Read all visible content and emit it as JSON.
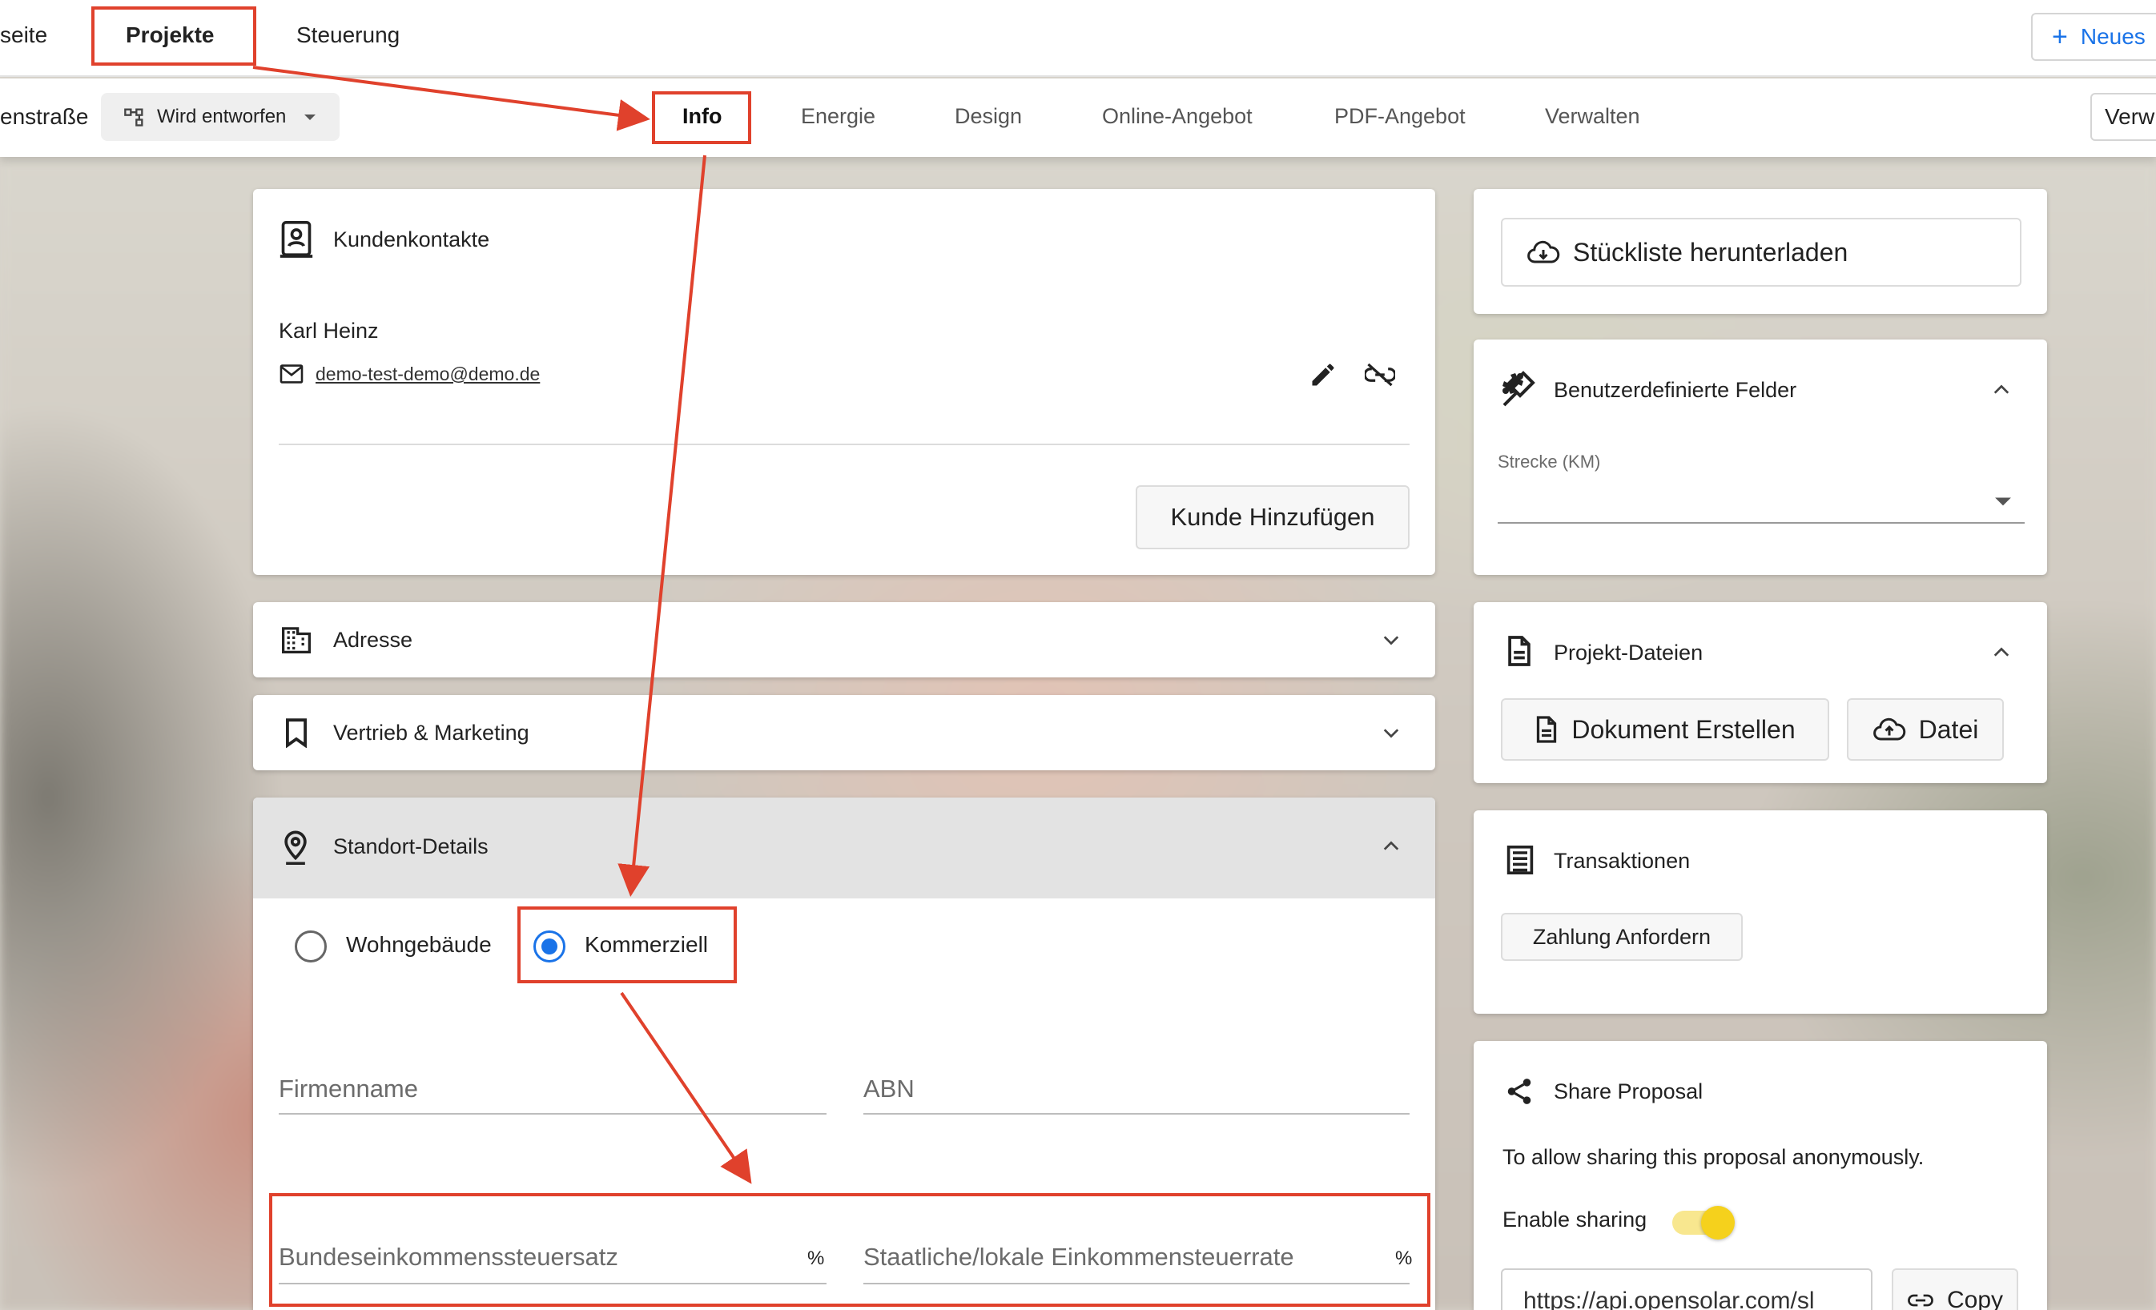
{
  "topnav": {
    "items": [
      "seite",
      "Projekte",
      "Steuerung"
    ],
    "new_button": "Neues"
  },
  "subnav": {
    "project_name": "enstraße",
    "status": "Wird entworfen",
    "tabs": [
      "Info",
      "Energie",
      "Design",
      "Online-Angebot",
      "PDF-Angebot",
      "Verwalten"
    ],
    "right_button": "Verw"
  },
  "customer_contacts": {
    "title": "Kundenkontakte",
    "contact_name": "Karl Heinz",
    "contact_email": "demo-test-demo@demo.de",
    "add_button": "Kunde Hinzufügen"
  },
  "address": {
    "title": "Adresse"
  },
  "sales_marketing": {
    "title": "Vertrieb & Marketing"
  },
  "site_details": {
    "title": "Standort-Details",
    "radio_residential": "Wohngebäude",
    "radio_commercial": "Kommerziell",
    "selected": "Kommerziell",
    "company_name_label": "Firmenname",
    "abn_label": "ABN",
    "federal_tax_label": "Bundeseinkommenssteuersatz",
    "state_tax_label": "Staatliche/lokale Einkommensteuerrate",
    "percent_symbol": "%"
  },
  "bom": {
    "download_button": "Stückliste herunterladen"
  },
  "custom_fields": {
    "title": "Benutzerdefinierte Felder",
    "distance_label": "Strecke (KM)"
  },
  "project_files": {
    "title": "Projekt-Dateien",
    "create_doc_button": "Dokument Erstellen",
    "file_button": "Datei"
  },
  "transactions": {
    "title": "Transaktionen",
    "request_payment_button": "Zahlung Anfordern"
  },
  "share_proposal": {
    "title": "Share Proposal",
    "description": "To allow sharing this proposal anonymously.",
    "enable_label": "Enable sharing",
    "enabled": true,
    "url": "https://api.opensolar.com/sl",
    "copy_button": "Copy"
  },
  "colors": {
    "annotation_red": "#e0412c",
    "accent_blue": "#1a73e8",
    "toggle_yellow": "#f5d11c"
  }
}
